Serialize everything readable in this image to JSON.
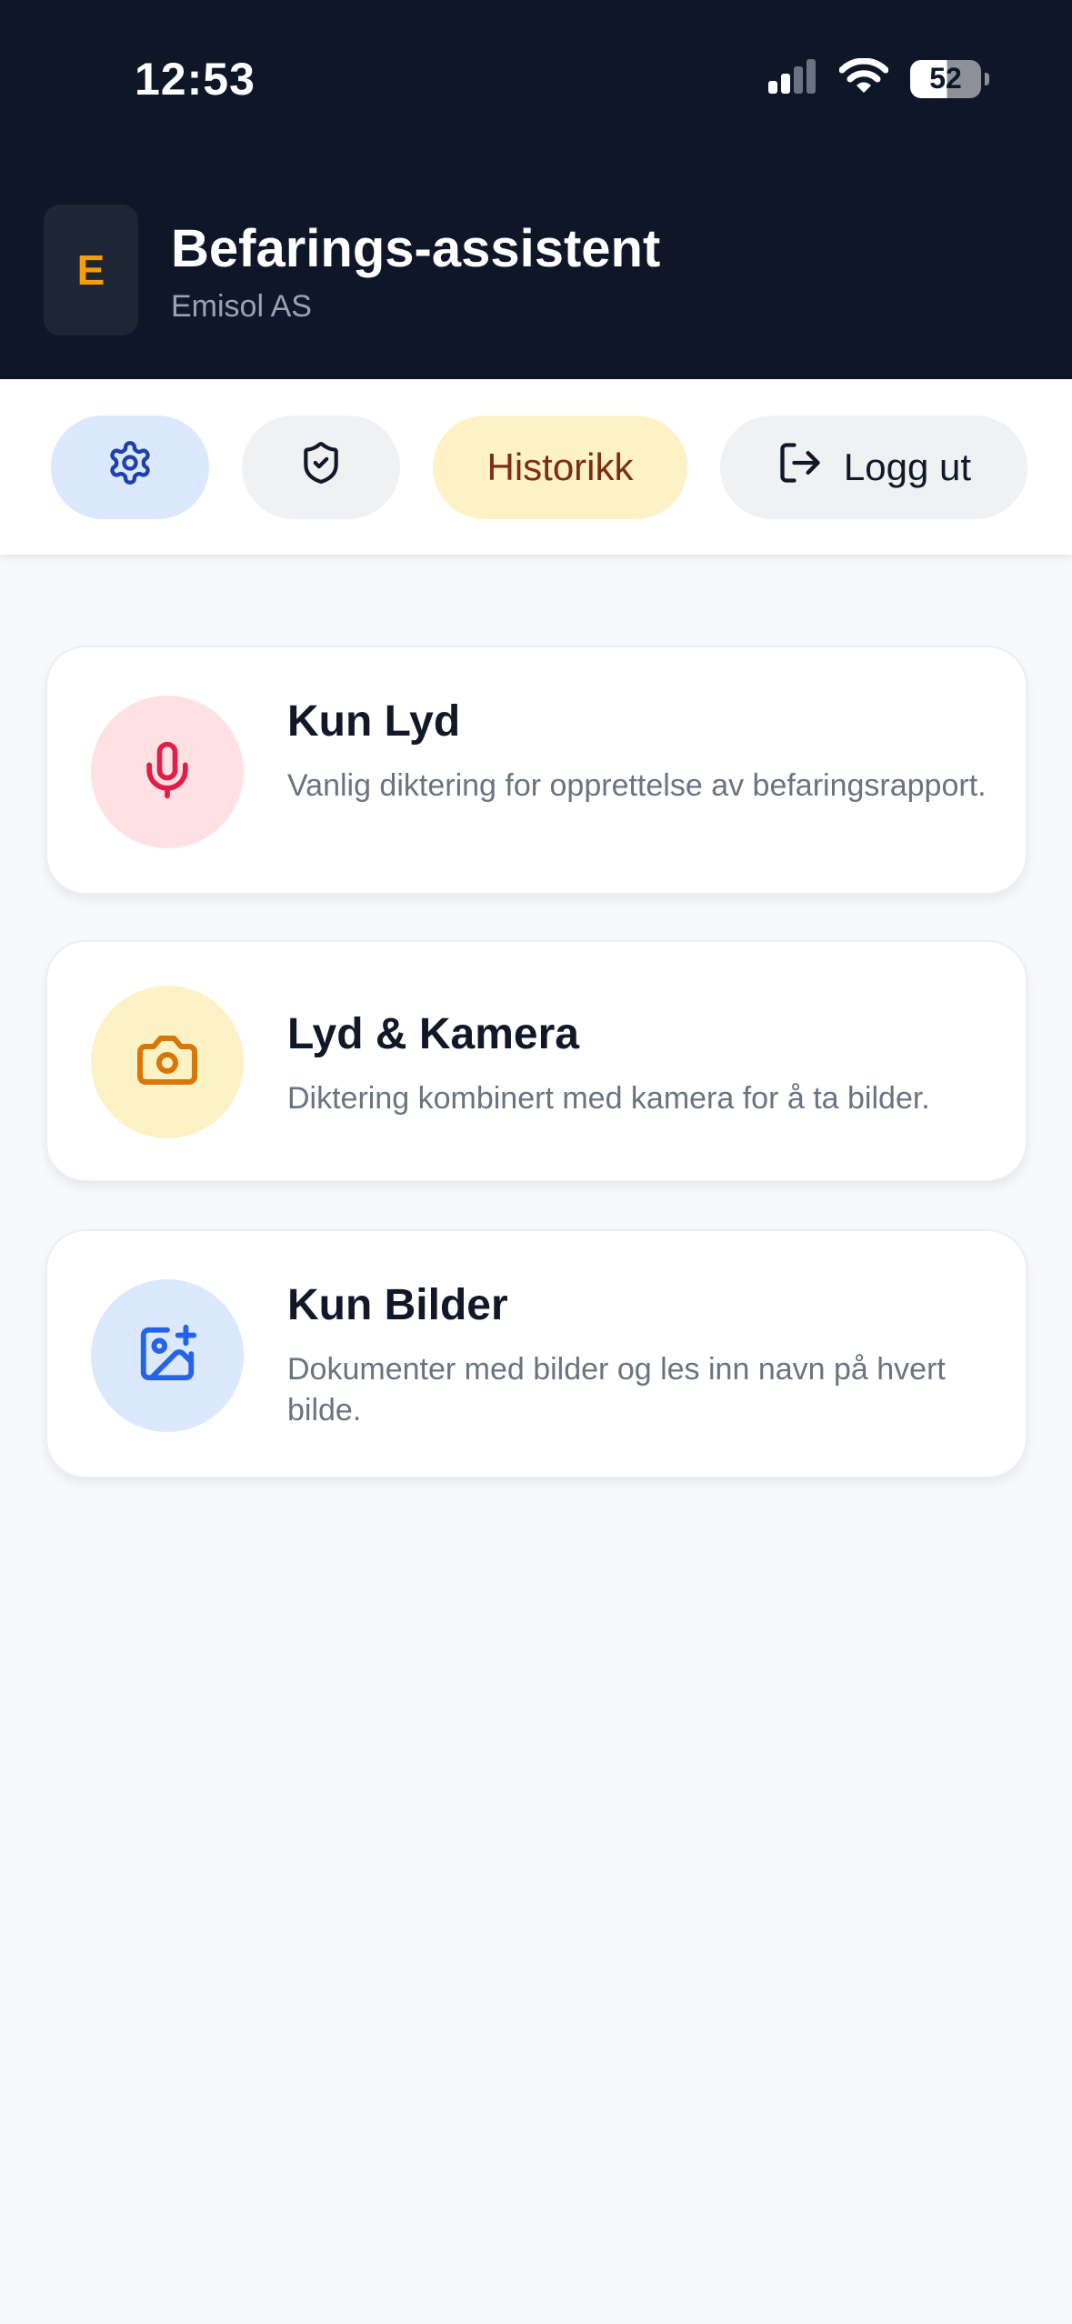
{
  "status_bar": {
    "time": "12:53",
    "battery": "52",
    "icons": [
      "cellular-signal-icon",
      "wifi-icon",
      "battery-icon"
    ]
  },
  "header": {
    "logo_letter": "E",
    "title": "Befarings-assistent",
    "subtitle": "Emisol AS"
  },
  "toolbar": {
    "settings_icon": "gear-icon",
    "security_icon": "shield-check-icon",
    "history_label": "Historikk",
    "logout_icon": "logout-icon",
    "logout_label": "Logg ut"
  },
  "modes": [
    {
      "icon": "microphone-icon",
      "title": "Kun Lyd",
      "description": "Vanlig diktering for opprettelse av befaringsrapport."
    },
    {
      "icon": "camera-icon",
      "title": "Lyd & Kamera",
      "description": "Diktering kombinert med kamera for å ta bilder."
    },
    {
      "icon": "image-plus-icon",
      "title": "Kun Bilder",
      "description": "Dokumenter med bilder og les inn navn på hvert bilde."
    }
  ],
  "colors": {
    "header_bg": "#0f1627",
    "accent_orange": "#f59e0b",
    "mic_red": "#e11d48",
    "camera_orange": "#d97706",
    "image_blue": "#2563eb",
    "settings_blue": "#1e40af"
  }
}
